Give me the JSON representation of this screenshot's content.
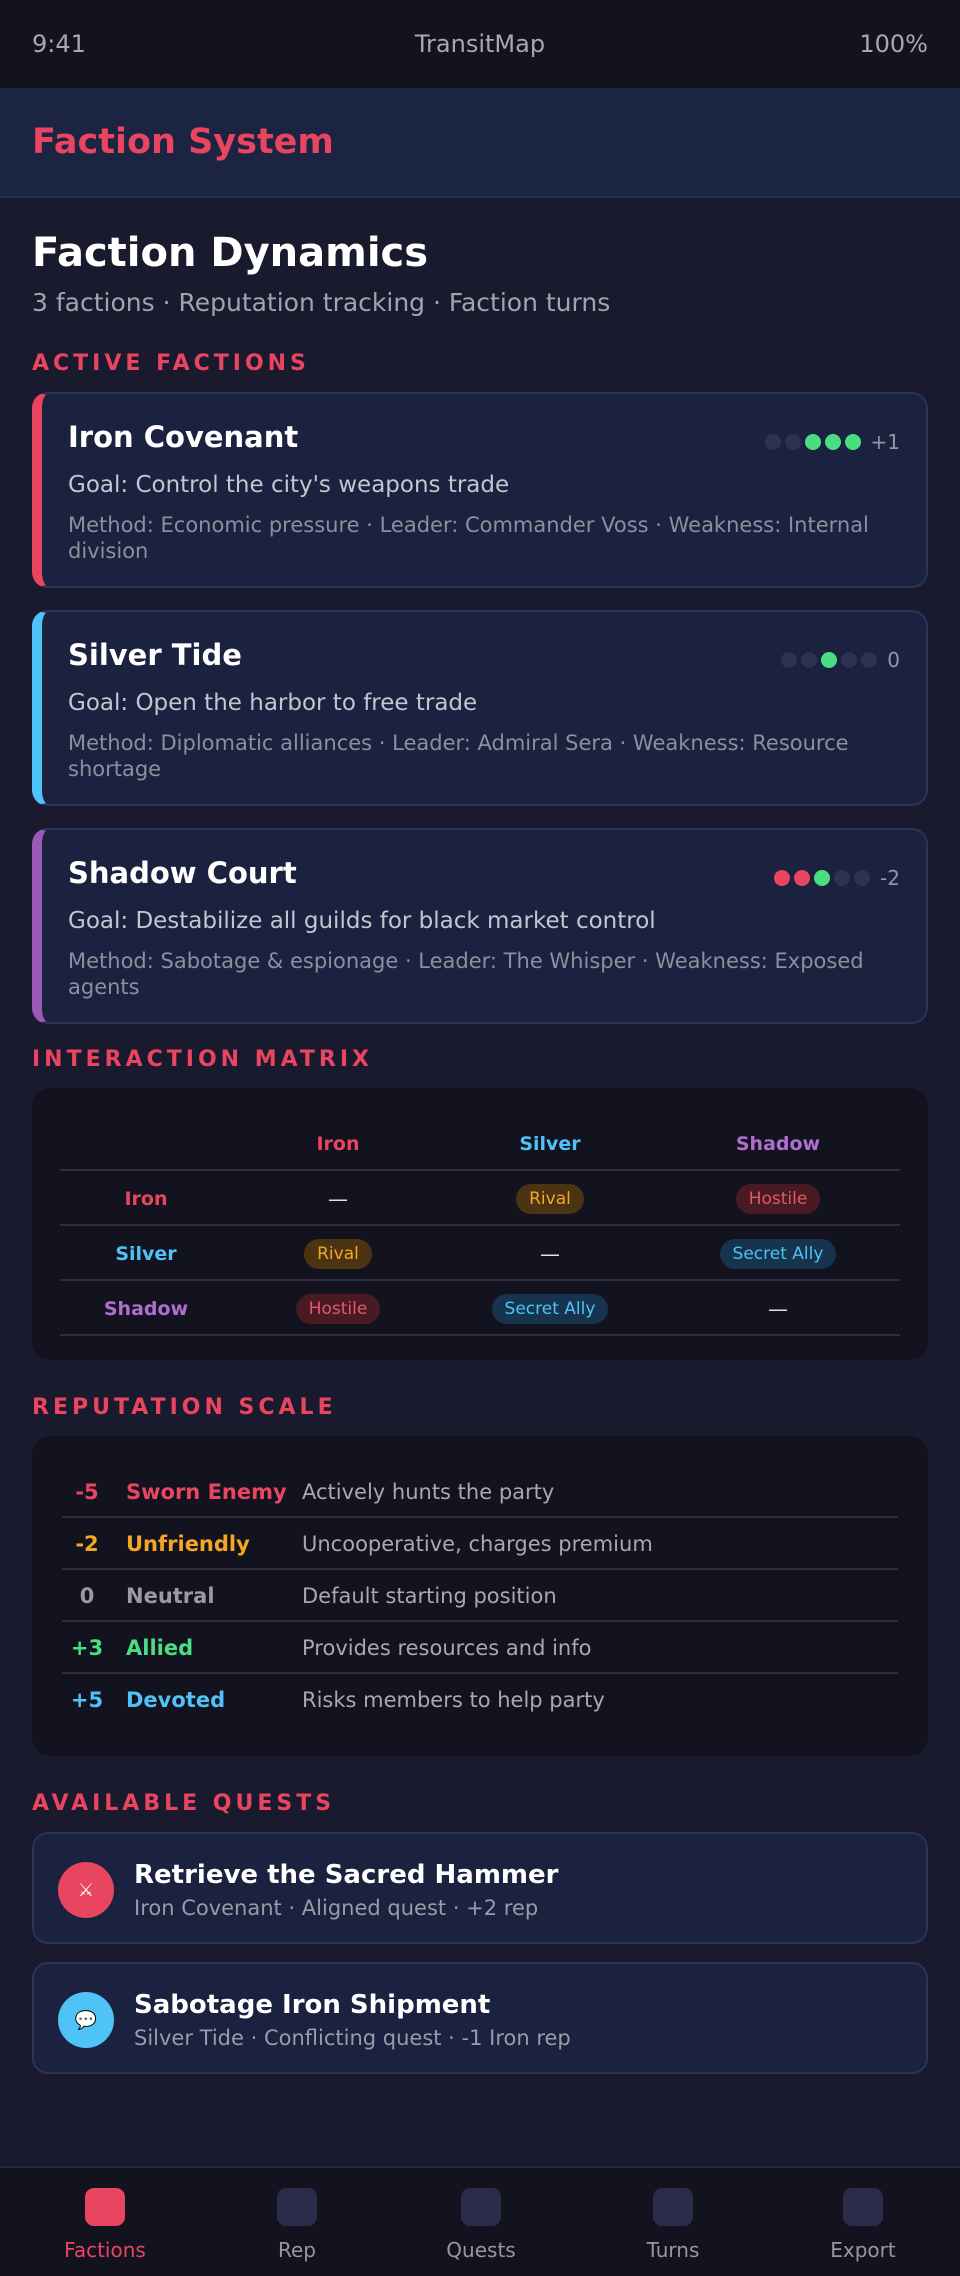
{
  "status_bar": {
    "time": "9:41",
    "app_name": "TransitMap",
    "battery": "100%"
  },
  "header": {
    "title": "Faction System"
  },
  "page": {
    "title": "Faction Dynamics",
    "subtitle": "3 factions · Reputation tracking · Faction turns"
  },
  "sections": {
    "active_factions": "ACTIVE FACTIONS",
    "interaction_matrix": "INTERACTION MATRIX",
    "reputation_scale": "REPUTATION SCALE",
    "available_quests": "AVAILABLE QUESTS"
  },
  "factions": [
    {
      "name": "Iron Covenant",
      "goal": "Goal: Control the city's weapons trade",
      "meta": "Method: Economic pressure · Leader: Commander Voss · Weakness: Internal division",
      "accent": "#e94560",
      "reputation": "+1",
      "dots": [
        "#2c3252",
        "#2c3252",
        "#4ade80",
        "#4ade80",
        "#4ade80"
      ]
    },
    {
      "name": "Silver Tide",
      "goal": "Goal: Open the harbor to free trade",
      "meta": "Method: Diplomatic alliances · Leader: Admiral Sera · Weakness: Resource shortage",
      "accent": "#4fc3f7",
      "reputation": "0",
      "dots": [
        "#2c3252",
        "#2c3252",
        "#4ade80",
        "#2c3252",
        "#2c3252"
      ]
    },
    {
      "name": "Shadow Court",
      "goal": "Goal: Destabilize all guilds for black market control",
      "meta": "Method: Sabotage & espionage · Leader: The Whisper · Weakness: Exposed agents",
      "accent": "#9b59b6",
      "reputation": "-2",
      "dots": [
        "#e94560",
        "#e94560",
        "#4ade80",
        "#2c3252",
        "#2c3252"
      ]
    }
  ],
  "matrix": {
    "headers": [
      "Iron",
      "Silver",
      "Shadow"
    ],
    "header_colors": [
      "#e94560",
      "#4fc3f7",
      "#b06fd0"
    ],
    "rows": [
      {
        "label": "Iron",
        "color": "#e94560",
        "cells": [
          {
            "text": "—",
            "kind": "dash"
          },
          {
            "text": "Rival",
            "kind": "rival"
          },
          {
            "text": "Hostile",
            "kind": "hostile"
          }
        ]
      },
      {
        "label": "Silver",
        "color": "#4fc3f7",
        "cells": [
          {
            "text": "Rival",
            "kind": "rival"
          },
          {
            "text": "—",
            "kind": "dash"
          },
          {
            "text": "Secret Ally",
            "kind": "ally"
          }
        ]
      },
      {
        "label": "Shadow",
        "color": "#b06fd0",
        "cells": [
          {
            "text": "Hostile",
            "kind": "hostile"
          },
          {
            "text": "Secret Ally",
            "kind": "ally"
          },
          {
            "text": "—",
            "kind": "dash"
          }
        ]
      }
    ]
  },
  "reputation_scale": [
    {
      "value": "-5",
      "label": "Sworn Enemy",
      "desc": "Actively hunts the party",
      "color": "#e94560"
    },
    {
      "value": "-2",
      "label": "Unfriendly",
      "desc": "Uncooperative, charges premium",
      "color": "#f5a623"
    },
    {
      "value": "0",
      "label": "Neutral",
      "desc": "Default starting position",
      "color": "#9a9aa6"
    },
    {
      "value": "+3",
      "label": "Allied",
      "desc": "Provides resources and info",
      "color": "#4ade80"
    },
    {
      "value": "+5",
      "label": "Devoted",
      "desc": "Risks members to help party",
      "color": "#4fc3f7"
    }
  ],
  "quests": [
    {
      "title": "Retrieve the Sacred Hammer",
      "meta": "Iron Covenant · Aligned quest · +2 rep",
      "icon": "crossed-swords-icon",
      "glyph": "⚔",
      "color": "#e94560"
    },
    {
      "title": "Sabotage Iron Shipment",
      "meta": "Silver Tide · Conflicting quest · -1 Iron rep",
      "icon": "speech-bubble-icon",
      "glyph": "💬",
      "color": "#4fc3f7"
    }
  ],
  "nav": [
    {
      "label": "Factions",
      "active": true
    },
    {
      "label": "Rep",
      "active": false
    },
    {
      "label": "Quests",
      "active": false
    },
    {
      "label": "Turns",
      "active": false
    },
    {
      "label": "Export",
      "active": false
    }
  ]
}
